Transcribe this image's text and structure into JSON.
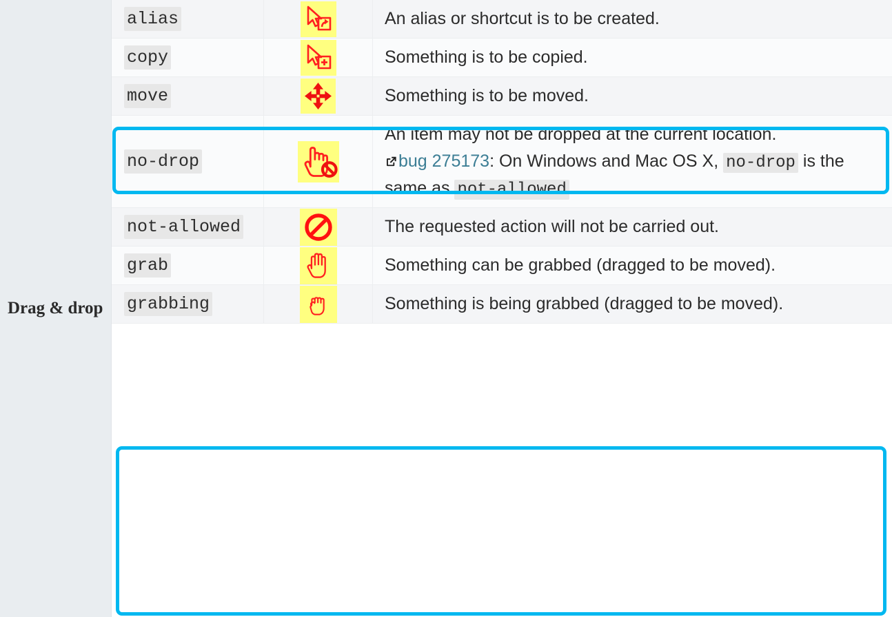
{
  "sidebar": {
    "row_header": "Drag & drop"
  },
  "colors": {
    "highlight": "#00b8f0",
    "link": "#3c7e95",
    "code_bg": "#e7e7e7",
    "icon_swatch_bg": "#ffff80",
    "icon_stroke": "#ff2020",
    "row_odd_bg": "#f4f5f7",
    "row_even_bg": "#fafbfc",
    "sidebar_bg": "#e9edf0"
  },
  "table": {
    "rows": [
      {
        "keyword": "alias",
        "icon_name": "cursor-alias-icon",
        "desc_parts": [
          {
            "type": "text",
            "text": "An alias or shortcut is to be created."
          }
        ],
        "highlighted": false,
        "stripe": "odd"
      },
      {
        "keyword": "copy",
        "icon_name": "cursor-copy-icon",
        "desc_parts": [
          {
            "type": "text",
            "text": "Something is to be copied."
          }
        ],
        "highlighted": false,
        "stripe": "even"
      },
      {
        "keyword": "move",
        "icon_name": "cursor-move-icon",
        "desc_parts": [
          {
            "type": "text",
            "text": "Something is to be moved."
          }
        ],
        "highlighted": true,
        "stripe": "odd"
      },
      {
        "keyword": "no-drop",
        "icon_name": "cursor-no-drop-icon",
        "desc_parts": [
          {
            "type": "text",
            "text": "An item may not be dropped at the current location."
          },
          {
            "type": "break"
          },
          {
            "type": "link",
            "text": "bug 275173",
            "icon": "external-link-icon"
          },
          {
            "type": "text",
            "text": ": On Windows and Mac OS X, "
          },
          {
            "type": "code",
            "text": "no-drop"
          },
          {
            "type": "text",
            "text": " is the same as "
          },
          {
            "type": "code",
            "text": "not-allowed"
          },
          {
            "type": "text",
            "text": "."
          }
        ],
        "highlighted": false,
        "stripe": "even"
      },
      {
        "keyword": "not-allowed",
        "icon_name": "cursor-not-allowed-icon",
        "desc_parts": [
          {
            "type": "text",
            "text": "The requested action will not be carried out."
          }
        ],
        "highlighted": false,
        "stripe": "odd"
      },
      {
        "keyword": "grab",
        "icon_name": "cursor-grab-icon",
        "desc_parts": [
          {
            "type": "text",
            "text": "Something can be grabbed (dragged to be moved)."
          }
        ],
        "highlighted": true,
        "stripe": "even"
      },
      {
        "keyword": "grabbing",
        "icon_name": "cursor-grabbing-icon",
        "desc_parts": [
          {
            "type": "text",
            "text": "Something is being grabbed (dragged to be moved)."
          }
        ],
        "highlighted": true,
        "stripe": "odd"
      }
    ]
  }
}
